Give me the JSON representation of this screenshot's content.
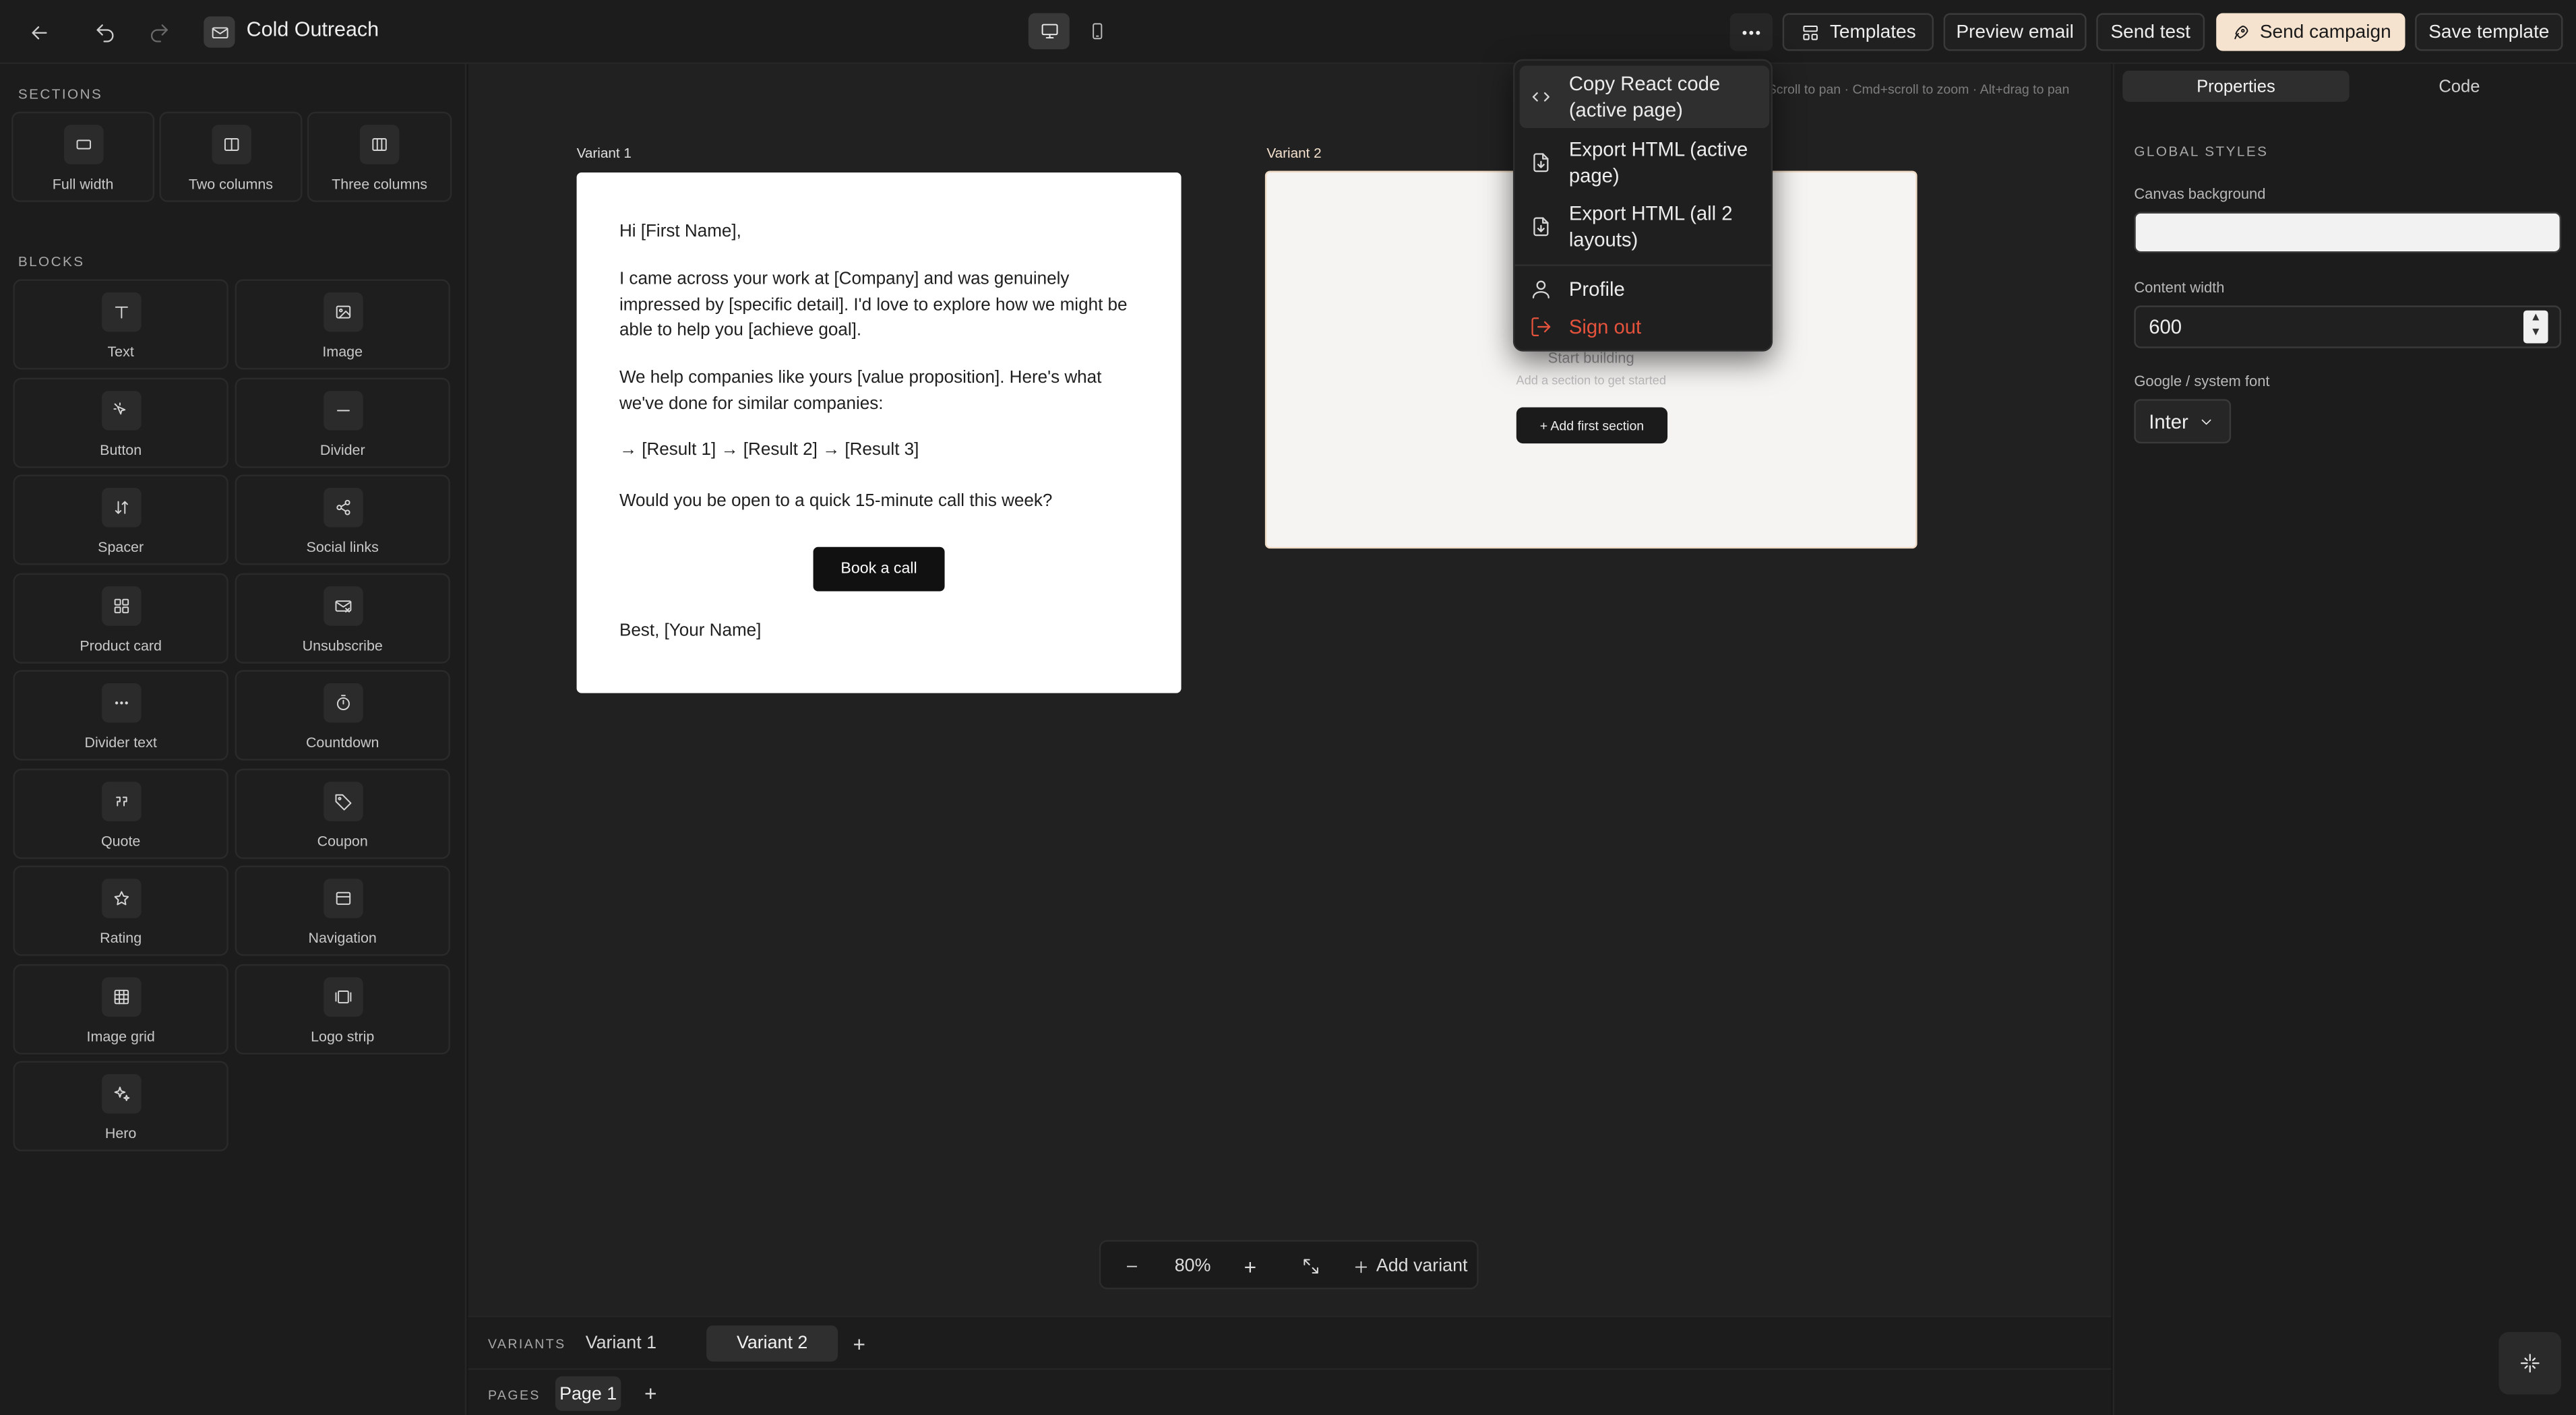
{
  "app": {
    "title": "Cold Outreach"
  },
  "toolbar": {
    "templates": "Templates",
    "preview_email": "Preview email",
    "send_test": "Send test",
    "send_campaign": "Send campaign",
    "save_template": "Save template"
  },
  "left_panel": {
    "sections_label": "SECTIONS",
    "sections": [
      "Full width",
      "Two columns",
      "Three columns"
    ],
    "blocks_label": "BLOCKS",
    "blocks": [
      "Text",
      "Image",
      "Button",
      "Divider",
      "Spacer",
      "Social links",
      "Product card",
      "Unsubscribe",
      "Divider text",
      "Countdown",
      "Quote",
      "Coupon",
      "Rating",
      "Navigation",
      "Image grid",
      "Logo strip",
      "Hero"
    ],
    "block_icons": [
      "text-icon",
      "image-icon",
      "button-icon",
      "divider-icon",
      "spacer-icon",
      "share-icon",
      "grid-icon",
      "mail-x-icon",
      "dots-icon",
      "timer-icon",
      "quote-icon",
      "tag-icon",
      "star-icon",
      "navigation-icon",
      "image-grid-icon",
      "logo-strip-icon",
      "sparkles-icon"
    ]
  },
  "canvas": {
    "hint": "Scroll to pan · Cmd+scroll to zoom · Alt+drag to pan",
    "variant1_label": "Variant 1",
    "variant2_label": "Variant 2",
    "email": {
      "greeting": "Hi [First Name],",
      "para1": "I came across your work at [Company] and was genuinely impressed by [specific detail]. I'd love to explore how we might be able to help you [achieve goal].",
      "para2": "We help companies like yours [value proposition]. Here's what we've done for similar companies:",
      "results": "→ [Result 1] → [Result 2] → [Result 3]",
      "question": "Would you be open to a quick 15-minute call this week?",
      "cta": "Book a call",
      "signoff": "Best, [Your Name]"
    },
    "empty": {
      "title": "Start building",
      "subtitle": "Add a section to get started",
      "button": "+ Add first section"
    }
  },
  "zoom": {
    "minus": "–",
    "level": "80%",
    "plus": "+",
    "add_variant": "Add variant"
  },
  "variants_bar": {
    "label": "VARIANTS",
    "items": [
      "Variant 1",
      "Variant 2"
    ],
    "active": "Variant 2",
    "add": "+"
  },
  "pages_bar": {
    "label": "PAGES",
    "items": [
      "Page 1"
    ],
    "add": "+"
  },
  "right_panel": {
    "tabs": [
      "Properties",
      "Code"
    ],
    "active_tab": "Properties",
    "global_styles": "GLOBAL STYLES",
    "canvas_background_label": "Canvas background",
    "content_width_label": "Content width",
    "content_width_value": "600",
    "font_label": "Google / system font",
    "font_value": "Inter"
  },
  "dropdown": {
    "items": [
      {
        "label": "Copy React code (active page)",
        "icon": "code-icon"
      },
      {
        "label": "Export HTML (active page)",
        "icon": "file-export-icon"
      },
      {
        "label": "Export HTML (all 2 layouts)",
        "icon": "file-export-icon"
      },
      {
        "label": "Profile",
        "icon": "user-icon"
      },
      {
        "label": "Sign out",
        "icon": "sign-out-icon"
      }
    ]
  },
  "colors": {
    "accent": "#f6e3cf",
    "danger": "#e5533d",
    "background": "#181818"
  }
}
